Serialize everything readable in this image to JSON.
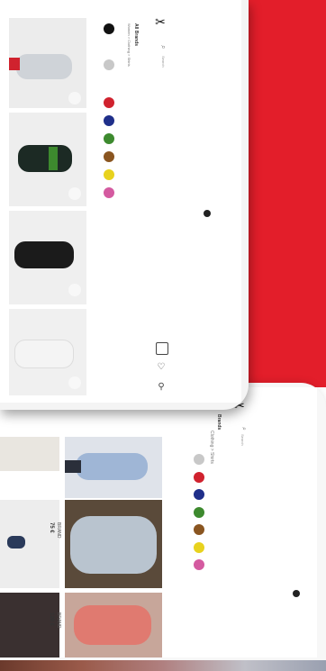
{
  "brand": {
    "logo_icon": "scissors-logo-icon"
  },
  "top_tablet": {
    "filter": {
      "label": "All Brands",
      "breadcrumb": "Women > Clothing > Shirts"
    },
    "search": {
      "label": "Search",
      "icon": "search-icon"
    },
    "colors": [
      "#111111",
      "#c8c8c8",
      "#d0222e",
      "#1f2f8a",
      "#3d8a2e",
      "#8a5520",
      "#e8d21e",
      "#d45aa0"
    ],
    "tool_icons": [
      "bag-icon",
      "heart-icon",
      "user-icon"
    ]
  },
  "bottom_tablet": {
    "filter": {
      "label": "Brands",
      "breadcrumb": "Clothing > Shirts"
    },
    "search": {
      "label": "Search",
      "icon": "search-icon"
    },
    "colors": [
      "#c8c8c8",
      "#d0222e",
      "#1f2f8a",
      "#3d8a2e",
      "#8a5520",
      "#e8d21e",
      "#d45aa0"
    ],
    "products": [
      {
        "brand": "BRAND",
        "price": "75 €"
      },
      {
        "brand": "BRAND",
        "price": "120 €"
      }
    ]
  },
  "colors": {
    "accent_red": "#e31e2a"
  }
}
